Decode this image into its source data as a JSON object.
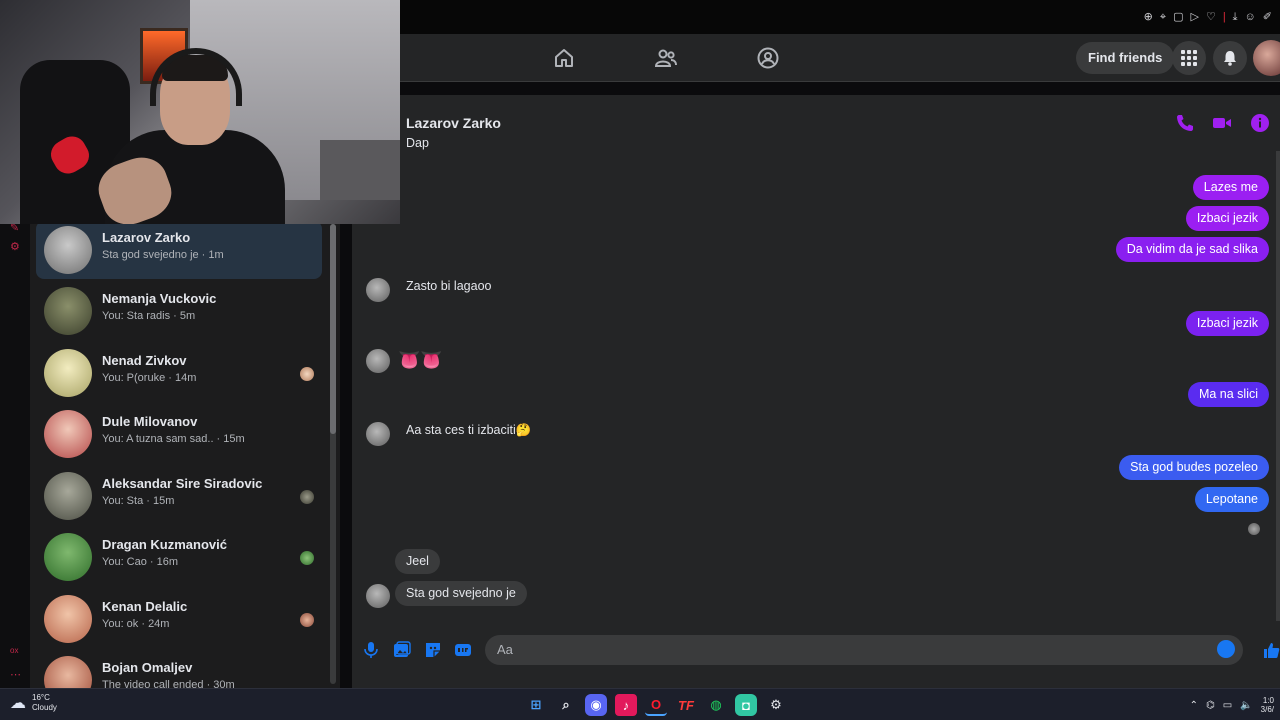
{
  "header": {
    "find_friends_label": "Find friends"
  },
  "conversation": {
    "title": "Lazarov Zarko",
    "composer_placeholder": "Aa",
    "messages": [
      {
        "dir": "in",
        "text": "Dap"
      },
      {
        "dir": "out",
        "text": "Lazes me"
      },
      {
        "dir": "out",
        "text": "Izbaci jezik"
      },
      {
        "dir": "out",
        "text": "Da vidim da je sad slika"
      },
      {
        "dir": "in",
        "text": "Zasto bi lagaoo"
      },
      {
        "dir": "out",
        "text": "Izbaci jezik"
      },
      {
        "dir": "in",
        "text": "👅👅"
      },
      {
        "dir": "out",
        "text": "Ma na slici"
      },
      {
        "dir": "in",
        "text": "Aa sta ces ti izbaciti🤔"
      },
      {
        "dir": "out",
        "text": "Sta god budes pozeleo"
      },
      {
        "dir": "out",
        "text": "Lepotane"
      },
      {
        "dir": "in",
        "text": "Jeel"
      },
      {
        "dir": "in",
        "text": "Sta god svejedno je"
      }
    ]
  },
  "chats": [
    {
      "name": "Lazarov Zarko",
      "preview": "Sta god svejedno je · 1m"
    },
    {
      "name": "Nemanja Vuckovic",
      "preview": "You: Sta radis · 5m"
    },
    {
      "name": "Nenad Zivkov",
      "preview": "You: P(oruke · 14m"
    },
    {
      "name": "Dule Milovanov",
      "preview": "You: A tuzna sam sad.. · 15m"
    },
    {
      "name": "Aleksandar Sire Siradovic",
      "preview": "You: Sta · 15m"
    },
    {
      "name": "Dragan Kuzmanović",
      "preview": "You: Cao · 16m"
    },
    {
      "name": "Kenan Delalic",
      "preview": "You: ok · 24m"
    },
    {
      "name": "Bojan Omaljev",
      "preview": "The video call ended · 30m"
    }
  ],
  "taskbar": {
    "temperature": "16°C",
    "condition": "Cloudy",
    "time": "1:0",
    "date": "3/6/"
  },
  "colors": {
    "accent_purple": "#9b1ff2",
    "accent_blue": "#3b5cf0",
    "messenger_blue": "#1877f2"
  }
}
